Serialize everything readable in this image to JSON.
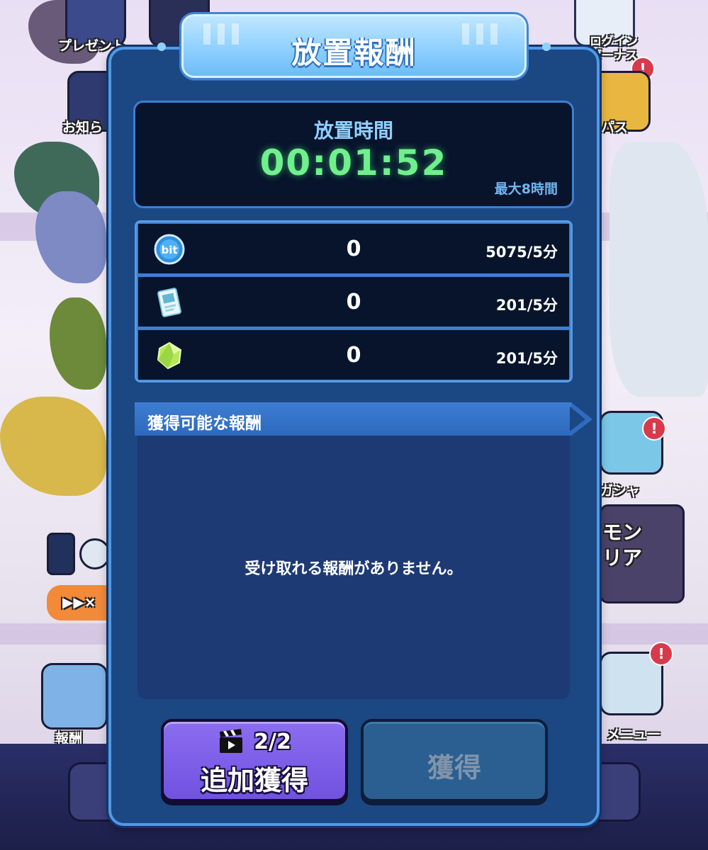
{
  "background": {
    "labels": {
      "present": "プレゼント",
      "notice": "お知ら",
      "login_bonus_line1": "ログイン",
      "login_bonus_line2": "ボーナス",
      "pass": "パス",
      "gacha": "ガシャ",
      "monster_area_line1": "モン",
      "monster_area_line2": "リア",
      "reward": "報酬",
      "menu": "メニュー",
      "speed": "▶▶×"
    },
    "badge": "!"
  },
  "dialog": {
    "title": "放置報酬",
    "timer": {
      "label": "放置時間",
      "value": "00:01:52",
      "max_note": "最大8時間"
    },
    "rewards": [
      {
        "icon": "bit-coin-icon",
        "icon_text": "bit",
        "amount": "0",
        "rate": "5075/5分"
      },
      {
        "icon": "ticket-icon",
        "amount": "0",
        "rate": "201/5分"
      },
      {
        "icon": "crystal-icon",
        "amount": "0",
        "rate": "201/5分"
      }
    ],
    "available": {
      "title": "獲得可能な報酬",
      "empty_message": "受け取れる報酬がありません。"
    },
    "buttons": {
      "extra_count": "2/2",
      "extra_label": "追加獲得",
      "get_label": "獲得"
    }
  },
  "colors": {
    "panel": "#1b4783",
    "timer_green": "#6ff08d",
    "extra_button": "#7152e0",
    "get_button_disabled": "#2b5f91"
  }
}
